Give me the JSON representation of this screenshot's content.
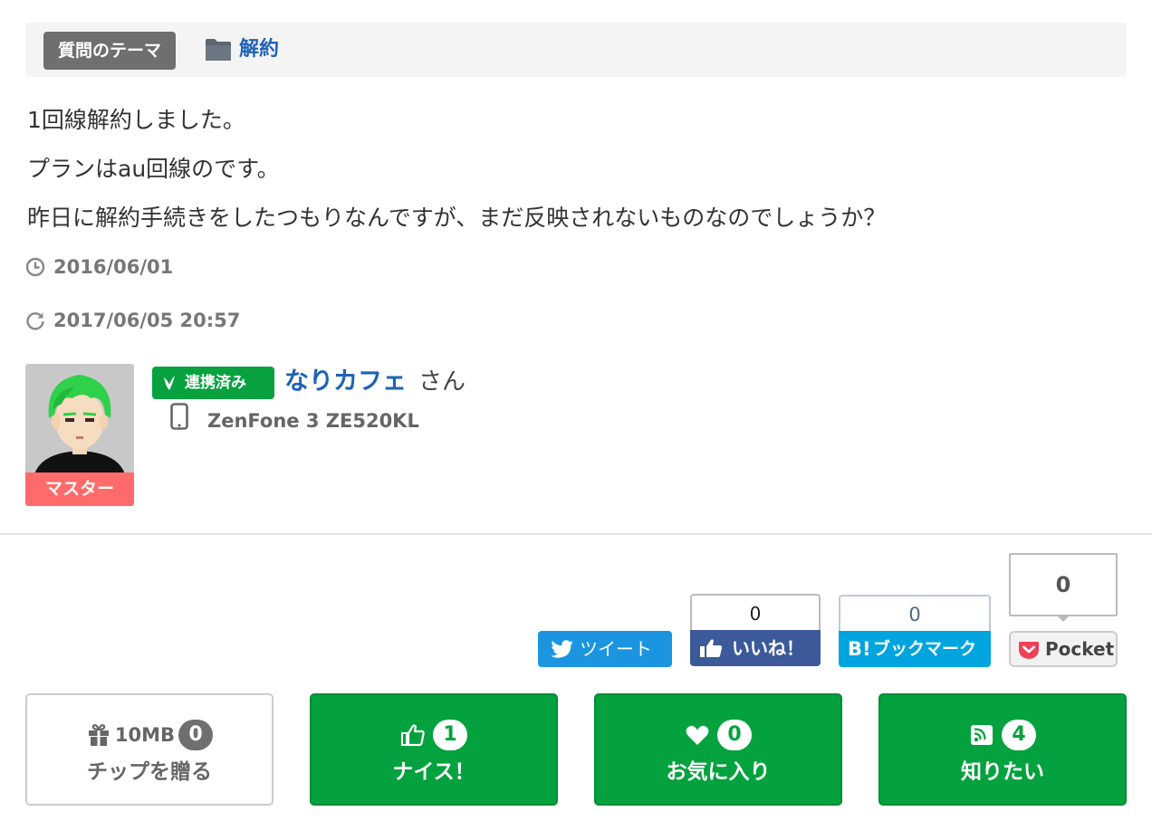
{
  "theme": {
    "badge": "質問のテーマ",
    "category": "解約",
    "folder_icon": "folder-icon"
  },
  "question": {
    "lines": [
      "1回線解約しました。",
      "プランはau回線のです。",
      "昨日に解約手続きをしたつもりなんですが、まだ反映されないものなのでしょうか？"
    ],
    "posted_date": "2016/06/01",
    "updated_date": "2017/06/05 20:57"
  },
  "user": {
    "rank": "マスター",
    "linked_badge": "連携済み",
    "name": "なりカフェ",
    "honorific": "さん",
    "device": "ZenFone 3 ZE520KL"
  },
  "social": {
    "tweet_label": "ツイート",
    "fb_count": "0",
    "fb_label": "いいね！",
    "hatena_count": "0",
    "hatena_b": "B!",
    "hatena_label": "ブックマーク",
    "pocket_count": "0",
    "pocket_label": "Pocket"
  },
  "actions": {
    "tip": {
      "amount": "10MB",
      "count": "0",
      "label": "チップを贈る"
    },
    "nice": {
      "count": "1",
      "label": "ナイス！"
    },
    "favorite": {
      "count": "0",
      "label": "お気に入り"
    },
    "want_to_know": {
      "count": "4",
      "label": "知りたい"
    }
  },
  "colors": {
    "accent_green": "#03a23e",
    "link_blue": "#1e63b3",
    "rank_red": "#ff6b6b",
    "twitter": "#1b95e0",
    "facebook": "#3c5a99",
    "hatena": "#00a4de",
    "pocket": "#ef4056"
  }
}
